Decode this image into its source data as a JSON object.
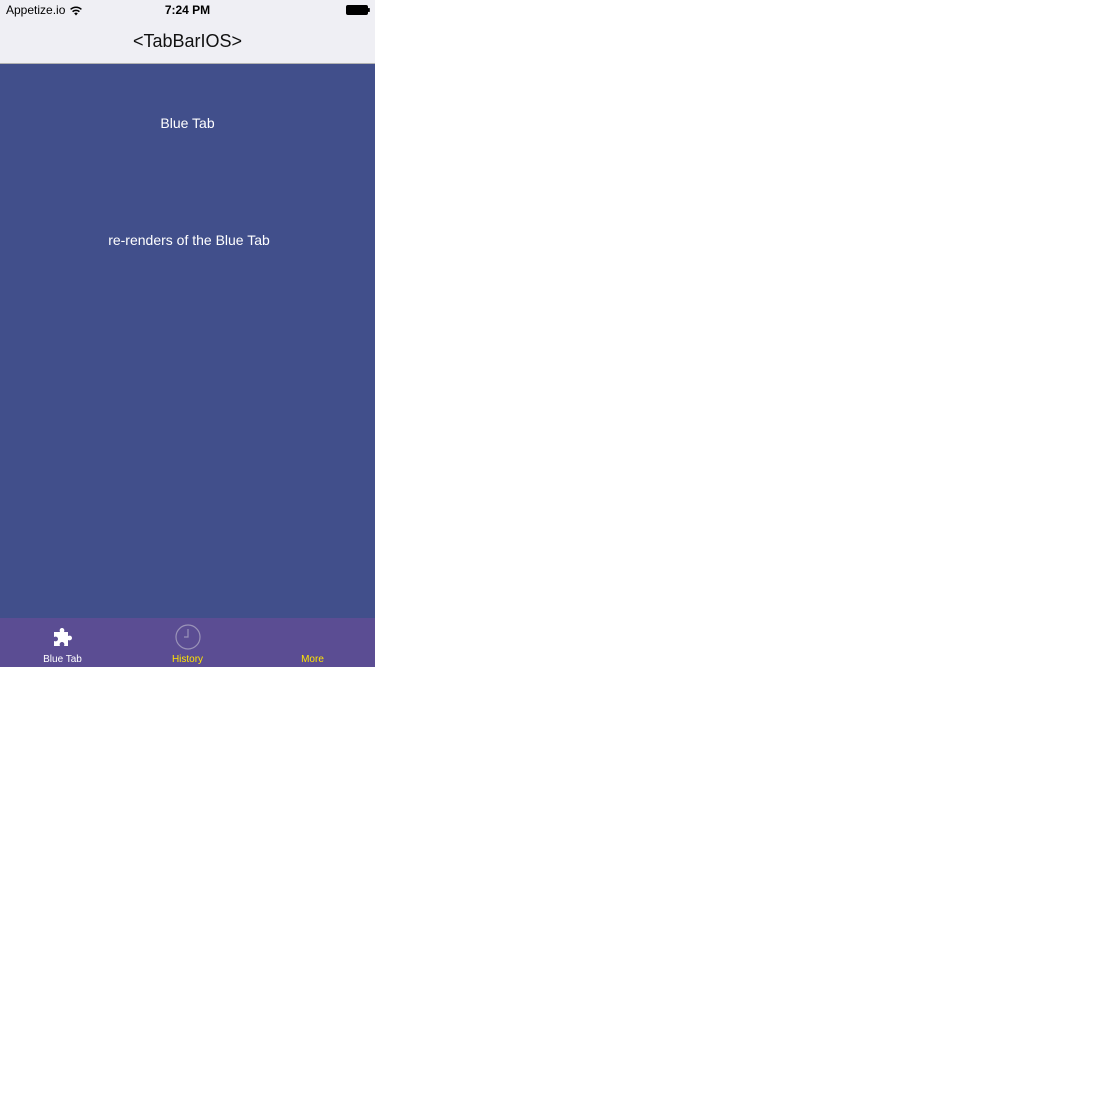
{
  "status_bar": {
    "carrier": "Appetize.io",
    "time": "7:24 PM",
    "icons": [
      "wifi-icon",
      "battery-icon"
    ]
  },
  "nav": {
    "title": "<TabBarIOS>"
  },
  "content": {
    "heading": "Blue Tab",
    "rerender_text": "re-renders of the Blue Tab",
    "background_color": "#414f8b"
  },
  "tab_bar": {
    "background_color": "#5b4d93",
    "selected_tint": "#ffffff",
    "unselected_tint": "#ffe400",
    "tabs": [
      {
        "label": "Blue Tab",
        "icon": "puzzle-piece-icon",
        "selected": true
      },
      {
        "label": "History",
        "icon": "clock-icon",
        "selected": false
      },
      {
        "label": "More",
        "icon": "none",
        "selected": false
      }
    ]
  }
}
